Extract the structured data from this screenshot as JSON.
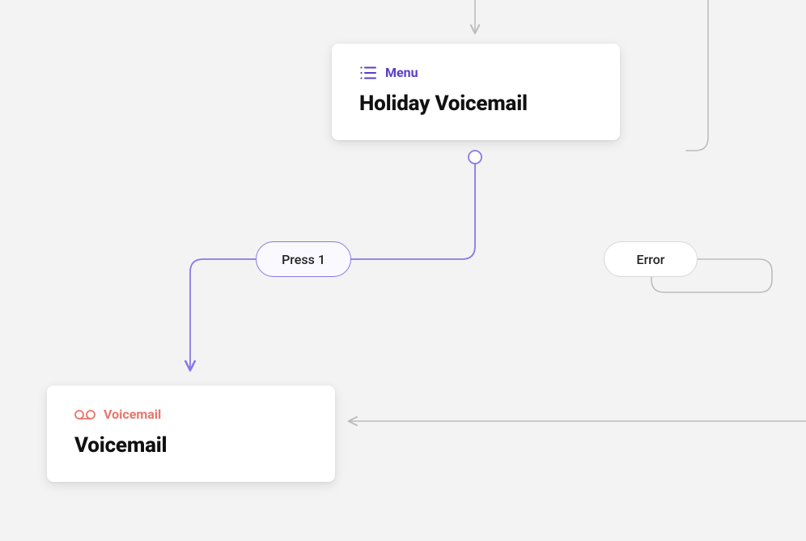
{
  "nodes": {
    "holiday": {
      "type_label": "Menu",
      "title": "Holiday Voicemail"
    },
    "voicemail": {
      "type_label": "Voicemail",
      "title": "Voicemail"
    }
  },
  "pills": {
    "press1": "Press 1",
    "error": "Error"
  },
  "colors": {
    "edge_purple": "#8a78e6",
    "edge_grey": "#bdbdbd",
    "menu_purple": "#5a3ec8",
    "voicemail_red": "#e9756b"
  }
}
